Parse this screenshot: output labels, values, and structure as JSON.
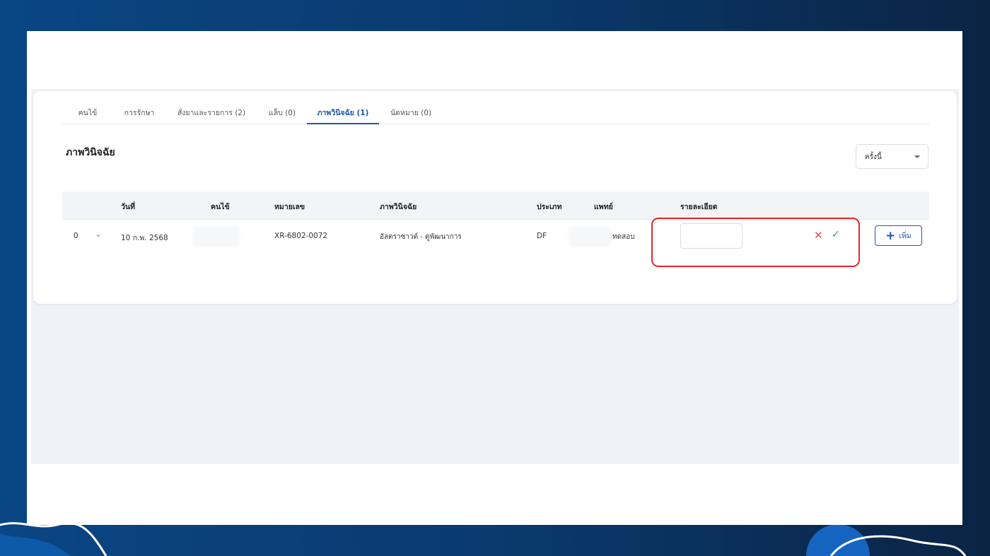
{
  "tabs": [
    {
      "label": "คนไข้"
    },
    {
      "label": "การรักษา"
    },
    {
      "label": "สั่งยาและรายการ (2)"
    },
    {
      "label": "แล็บ (0)"
    },
    {
      "label": "ภาพวินิจฉัย (1)"
    },
    {
      "label": "นัดหมาย (0)"
    }
  ],
  "active_tab": 4,
  "section_title": "ภาพวินิจฉัย",
  "filter_select": {
    "value": "ครั้งนี้"
  },
  "table": {
    "headers": {
      "date": "วันที่",
      "patient": "คนไข้",
      "number": "หมายเลข",
      "imaging": "ภาพวินิจฉัย",
      "type": "ประเภท",
      "doctor": "แพทย์",
      "detail": "รายละเอียด"
    },
    "rows": [
      {
        "index": "0",
        "date": "10 ก.พ. 2568",
        "number": "XR-6802-0072",
        "imaging": "อัลตราซาวด์ - ดูพัฒนาการ",
        "type": "DF",
        "doctor": "ทดสอบ",
        "detail": ""
      }
    ]
  },
  "add_button": "เพิ่ม",
  "colors": {
    "accent": "#1e56b0",
    "highlight": "#e5262e",
    "cancel": "#d9534f",
    "confirm": "#3a9a5b"
  }
}
